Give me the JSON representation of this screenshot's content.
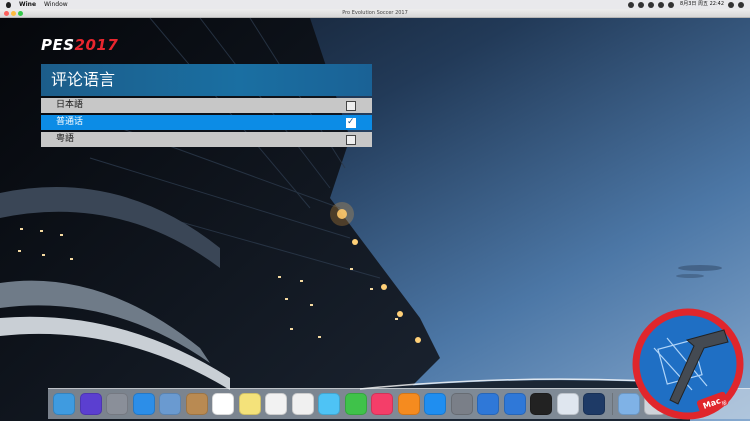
{
  "menubar": {
    "app_name": "Wine",
    "items": [
      "Window"
    ],
    "clock": "8月3日 周五 22:42"
  },
  "window": {
    "title": "Pro Evolution Soccer 2017"
  },
  "game": {
    "logo": {
      "pes": "PES",
      "year": "2017"
    },
    "panel": {
      "title": "评论语言",
      "options": [
        {
          "label": "日本語",
          "checked": false
        },
        {
          "label": "普通话",
          "checked": true
        },
        {
          "label": "粤語",
          "checked": false
        }
      ],
      "check_mark": "✓"
    }
  },
  "dock": {
    "apps": [
      {
        "icon": "finder-icon",
        "color": "#3f9be0"
      },
      {
        "icon": "siri-icon",
        "color": "#5b3fd0"
      },
      {
        "icon": "launchpad-icon",
        "color": "#8a8f99"
      },
      {
        "icon": "safari-icon",
        "color": "#2c8ee8"
      },
      {
        "icon": "photo-preview-icon",
        "color": "#6a9ad0"
      },
      {
        "icon": "notes-book-icon",
        "color": "#b98a52"
      },
      {
        "icon": "calendar-icon",
        "color": "#ffffff"
      },
      {
        "icon": "stickies-icon",
        "color": "#f4e27a"
      },
      {
        "icon": "reminders-icon",
        "color": "#f2f2f2"
      },
      {
        "icon": "photos-icon",
        "color": "#f0f0f0"
      },
      {
        "icon": "messages-icon",
        "color": "#4ec3f5"
      },
      {
        "icon": "facetime-icon",
        "color": "#3fc24a"
      },
      {
        "icon": "music-icon",
        "color": "#f43e69"
      },
      {
        "icon": "books-icon",
        "color": "#f58b1f"
      },
      {
        "icon": "app-store-icon",
        "color": "#1f8ef0"
      },
      {
        "icon": "system-preferences-icon",
        "color": "#7a7f88"
      },
      {
        "icon": "u-magnet-icon",
        "color": "#2f78d8"
      },
      {
        "icon": "u-magnet-alt-icon",
        "color": "#2f78d8"
      },
      {
        "icon": "qq-penguin-icon",
        "color": "#222222"
      },
      {
        "icon": "wine-app-icon",
        "color": "#dfe6ef"
      },
      {
        "icon": "pes-game-icon",
        "color": "#1e3a66"
      }
    ],
    "trailing": [
      {
        "icon": "downloads-folder-icon",
        "color": "#7fb2e6"
      },
      {
        "icon": "trash-icon",
        "color": "#cfd4da"
      }
    ]
  },
  "watermark": {
    "text": "Mac",
    "subtext": "版"
  }
}
